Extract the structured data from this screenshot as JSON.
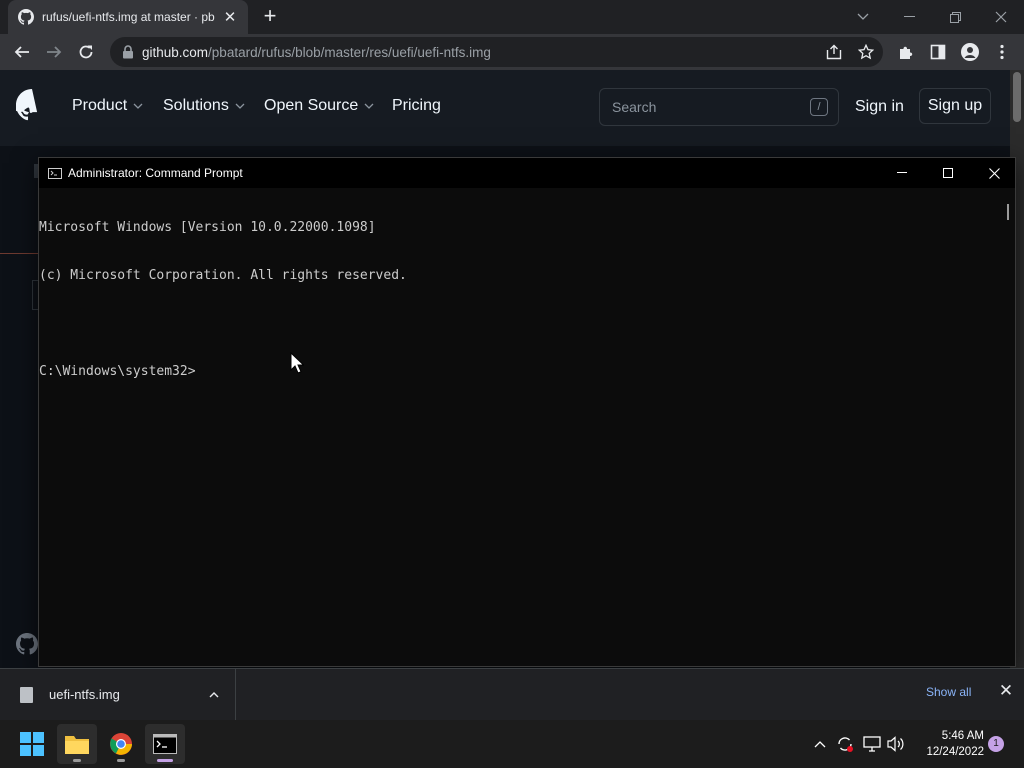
{
  "browser": {
    "tab": {
      "title": "rufus/uefi-ntfs.img at master · pb"
    },
    "address": {
      "host": "github.com",
      "path": "/pbatard/rufus/blob/master/res/uefi/uefi-ntfs.img"
    }
  },
  "github": {
    "nav": [
      "Product",
      "Solutions",
      "Open Source",
      "Pricing"
    ],
    "search": {
      "placeholder": "Search",
      "shortcut": "/"
    },
    "sign_in": "Sign in",
    "sign_up": "Sign up"
  },
  "cmd": {
    "title": "Administrator: Command Prompt",
    "lines": [
      "Microsoft Windows [Version 10.0.22000.1098]",
      "(c) Microsoft Corporation. All rights reserved.",
      "",
      "C:\\Windows\\system32>"
    ]
  },
  "downloads": {
    "file_name": "uefi-ntfs.img",
    "show_all": "Show all"
  },
  "taskbar": {
    "time": "5:46 AM",
    "date": "12/24/2022",
    "notification_count": "1"
  },
  "colors": {
    "browser_frame": "#202124",
    "browser_toolbar": "#35363a",
    "github_header": "#161b22",
    "github_bg": "#0d1117",
    "console_bg": "#0c0c0c",
    "console_text": "#cccccc",
    "link_blue": "#8ab4f8",
    "taskbar": "#1c1c1c"
  }
}
